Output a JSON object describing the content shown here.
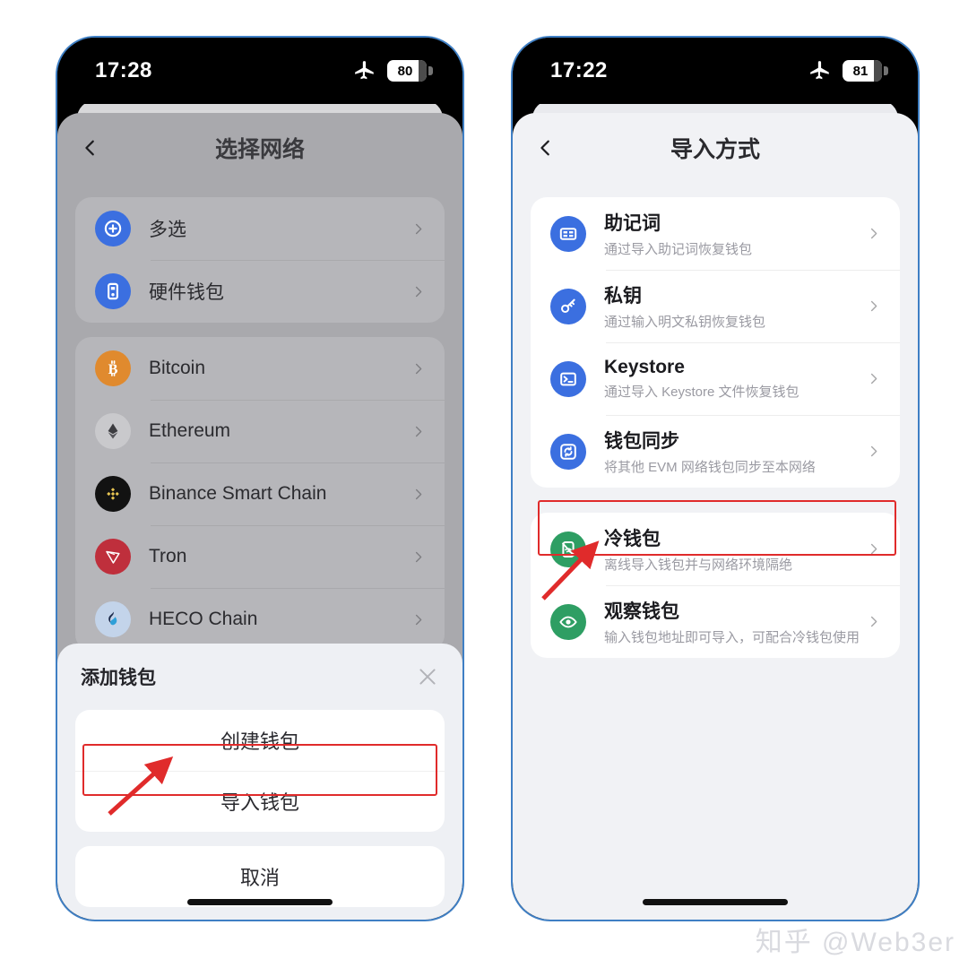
{
  "watermark": "知乎 @Web3er",
  "colors": {
    "frame_border": "#3f7fc4",
    "accent_blue": "#3b6fe0",
    "accent_green": "#2e9e63",
    "annotation_red": "#e02b2b",
    "page_bg": "#ffffff",
    "screen_bg": "#f1f2f5",
    "dim_overlay": "#a9a9ad"
  },
  "left_phone": {
    "status": {
      "time": "17:28",
      "airplane_icon": "airplane-icon",
      "battery": "80"
    },
    "nav": {
      "back_icon": "chevron-left-icon",
      "title": "选择网络"
    },
    "groups": [
      {
        "name": "wallet-type-group",
        "rows": [
          {
            "label": "多选",
            "icon": "multi-select-icon",
            "icon_bg": "#3b6fe0",
            "chevron": "chevron-right-icon"
          },
          {
            "label": "硬件钱包",
            "icon": "hardware-wallet-icon",
            "icon_bg": "#3b6fe0",
            "chevron": "chevron-right-icon"
          }
        ]
      },
      {
        "name": "network-group",
        "rows": [
          {
            "label": "Bitcoin",
            "icon": "bitcoin-icon",
            "icon_bg": "#e08a2e",
            "chevron": "chevron-right-icon"
          },
          {
            "label": "Ethereum",
            "icon": "ethereum-icon",
            "icon_bg": "#c9c9cc",
            "chevron": "chevron-right-icon"
          },
          {
            "label": "Binance Smart Chain",
            "icon": "binance-icon",
            "icon_bg": "#121212",
            "chevron": "chevron-right-icon"
          },
          {
            "label": "Tron",
            "icon": "tron-icon",
            "icon_bg": "#bf2f3c",
            "chevron": "chevron-right-icon"
          },
          {
            "label": "HECO Chain",
            "icon": "heco-icon",
            "icon_bg": "#c3d4ea",
            "chevron": "chevron-right-icon"
          }
        ]
      }
    ],
    "sheet": {
      "title": "添加钱包",
      "close_icon": "close-icon",
      "buttons": [
        {
          "label": "创建钱包",
          "name": "create-wallet-button",
          "highlighted": false
        },
        {
          "label": "导入钱包",
          "name": "import-wallet-button",
          "highlighted": true
        },
        {
          "label": "取消",
          "name": "cancel-button",
          "highlighted": false
        }
      ]
    }
  },
  "right_phone": {
    "status": {
      "time": "17:22",
      "airplane_icon": "airplane-icon",
      "battery": "81"
    },
    "nav": {
      "back_icon": "chevron-left-icon",
      "title": "导入方式"
    },
    "groups": [
      {
        "name": "import-methods-group",
        "rows": [
          {
            "title": "助记词",
            "subtitle": "通过导入助记词恢复钱包",
            "icon": "mnemonic-card-icon",
            "icon_bg": "#3b6fe0",
            "chevron": "chevron-right-icon"
          },
          {
            "title": "私钥",
            "subtitle": "通过输入明文私钥恢复钱包",
            "icon": "key-icon",
            "icon_bg": "#3b6fe0",
            "chevron": "chevron-right-icon"
          },
          {
            "title": "Keystore",
            "subtitle": "通过导入 Keystore 文件恢复钱包",
            "icon": "terminal-icon",
            "icon_bg": "#3b6fe0",
            "chevron": "chevron-right-icon"
          },
          {
            "title": "钱包同步",
            "subtitle": "将其他 EVM 网络钱包同步至本网络",
            "icon": "sync-icon",
            "icon_bg": "#3b6fe0",
            "chevron": "chevron-right-icon"
          }
        ]
      },
      {
        "name": "offline-wallet-group",
        "rows": [
          {
            "title": "冷钱包",
            "subtitle": "离线导入钱包并与网络环境隔绝",
            "icon": "cold-wallet-icon",
            "icon_bg": "#2e9e63",
            "chevron": "chevron-right-icon",
            "highlighted": true
          },
          {
            "title": "观察钱包",
            "subtitle": "输入钱包地址即可导入，可配合冷钱包使用",
            "icon": "eye-icon",
            "icon_bg": "#2e9e63",
            "chevron": "chevron-right-icon",
            "highlighted": false
          }
        ]
      }
    ]
  }
}
